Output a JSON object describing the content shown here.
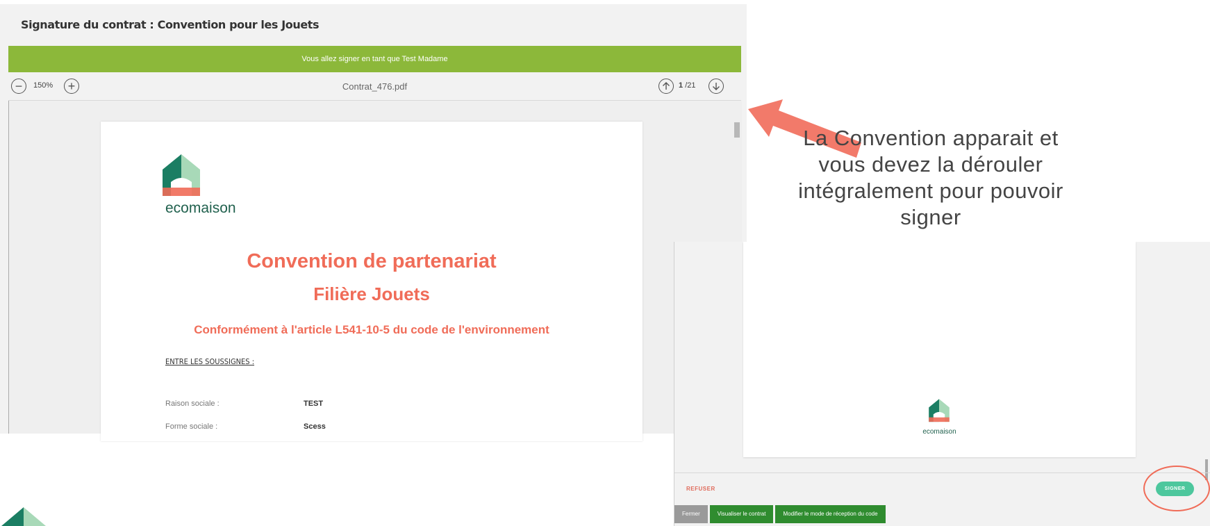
{
  "window": {
    "title": "Signature du contrat : Convention pour les Jouets",
    "banner": "Vous allez signer en tant que Test Madame"
  },
  "toolbar": {
    "zoom": "150%",
    "file_name": "Contrat_476.pdf",
    "page_current": "1",
    "page_total": "/21"
  },
  "document": {
    "brand": "ecomaison",
    "title": "Convention de partenariat",
    "subtitle": "Filière Jouets",
    "article": "Conformément à l'article L541-10-5 du code de l'environnement",
    "section": "ENTRE LES SOUSSIGNES :",
    "fields": [
      {
        "label": "Raison sociale :",
        "value": "TEST"
      },
      {
        "label": "Forme sociale :",
        "value": "Scess"
      }
    ]
  },
  "annotation": {
    "lines": [
      "La Convention apparait et",
      "vous devez la dérouler",
      "intégralement pour pouvoir",
      "signer"
    ]
  },
  "signing_panel": {
    "brand": "ecomaison",
    "refuse": "REFUSER",
    "sign": "SIGNER",
    "buttons": {
      "close": "Fermer",
      "view": "Visualiser le contrat",
      "change_mode": "Modifier le mode de réception du code"
    }
  },
  "colors": {
    "banner_green": "#8cb83a",
    "accent_coral": "#f06c58",
    "sign_teal": "#4dc79d",
    "footer_green": "#2f8c2f",
    "brand_dark_green": "#21614e"
  }
}
